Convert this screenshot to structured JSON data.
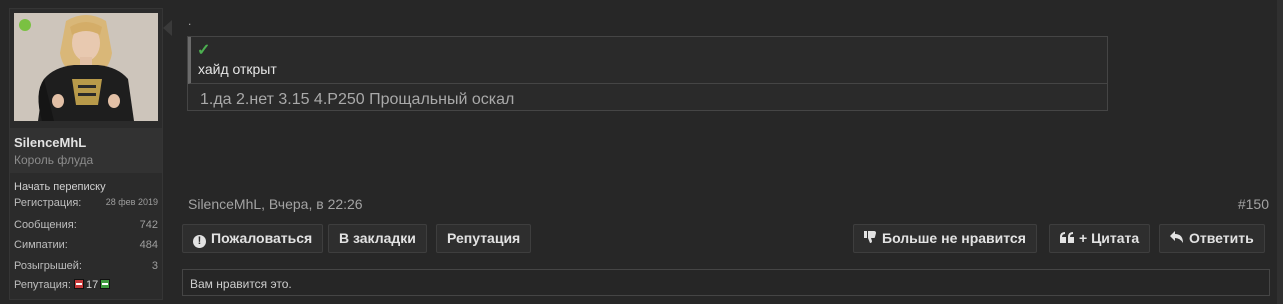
{
  "user": {
    "name": "SilenceMhL",
    "title": "Король флуда",
    "conversation_link": "Начать переписку",
    "stats": [
      {
        "label": "Регистрация:",
        "value": "28 фев 2019",
        "small": true
      },
      {
        "label": "Сообщения:",
        "value": "742"
      },
      {
        "label": "Симпатии:",
        "value": "484"
      },
      {
        "label": "Розыгрышей:",
        "value": "3"
      }
    ],
    "reputation_label": "Репутация:",
    "reputation_value": "17"
  },
  "post": {
    "dot": ".",
    "hide_check_icon": "✓",
    "hide_label": "хайд открыт",
    "hide_content": "1.да 2.нет 3.15 4.P250 Прощальный оскал",
    "meta": "SilenceMhL, Вчера, в 22:26",
    "number": "#150"
  },
  "actions": {
    "report": {
      "label": "Пожаловаться",
      "icon": "!"
    },
    "bookmark": {
      "label": "В закладки"
    },
    "reputation": {
      "label": "Репутация"
    },
    "unlike": {
      "label": "Больше не нравится",
      "icon": "thumbs-down-icon"
    },
    "quote": {
      "label": "+ Цитата",
      "icon": "quote-icon"
    },
    "reply": {
      "label": "Ответить",
      "icon": "reply-icon"
    }
  },
  "likes_text": "Вам нравится это.",
  "colors": {
    "online": "#7ac142",
    "check": "#4caf50",
    "rep_minus": "#c73b3b",
    "rep_plus": "#3f9a3f"
  }
}
